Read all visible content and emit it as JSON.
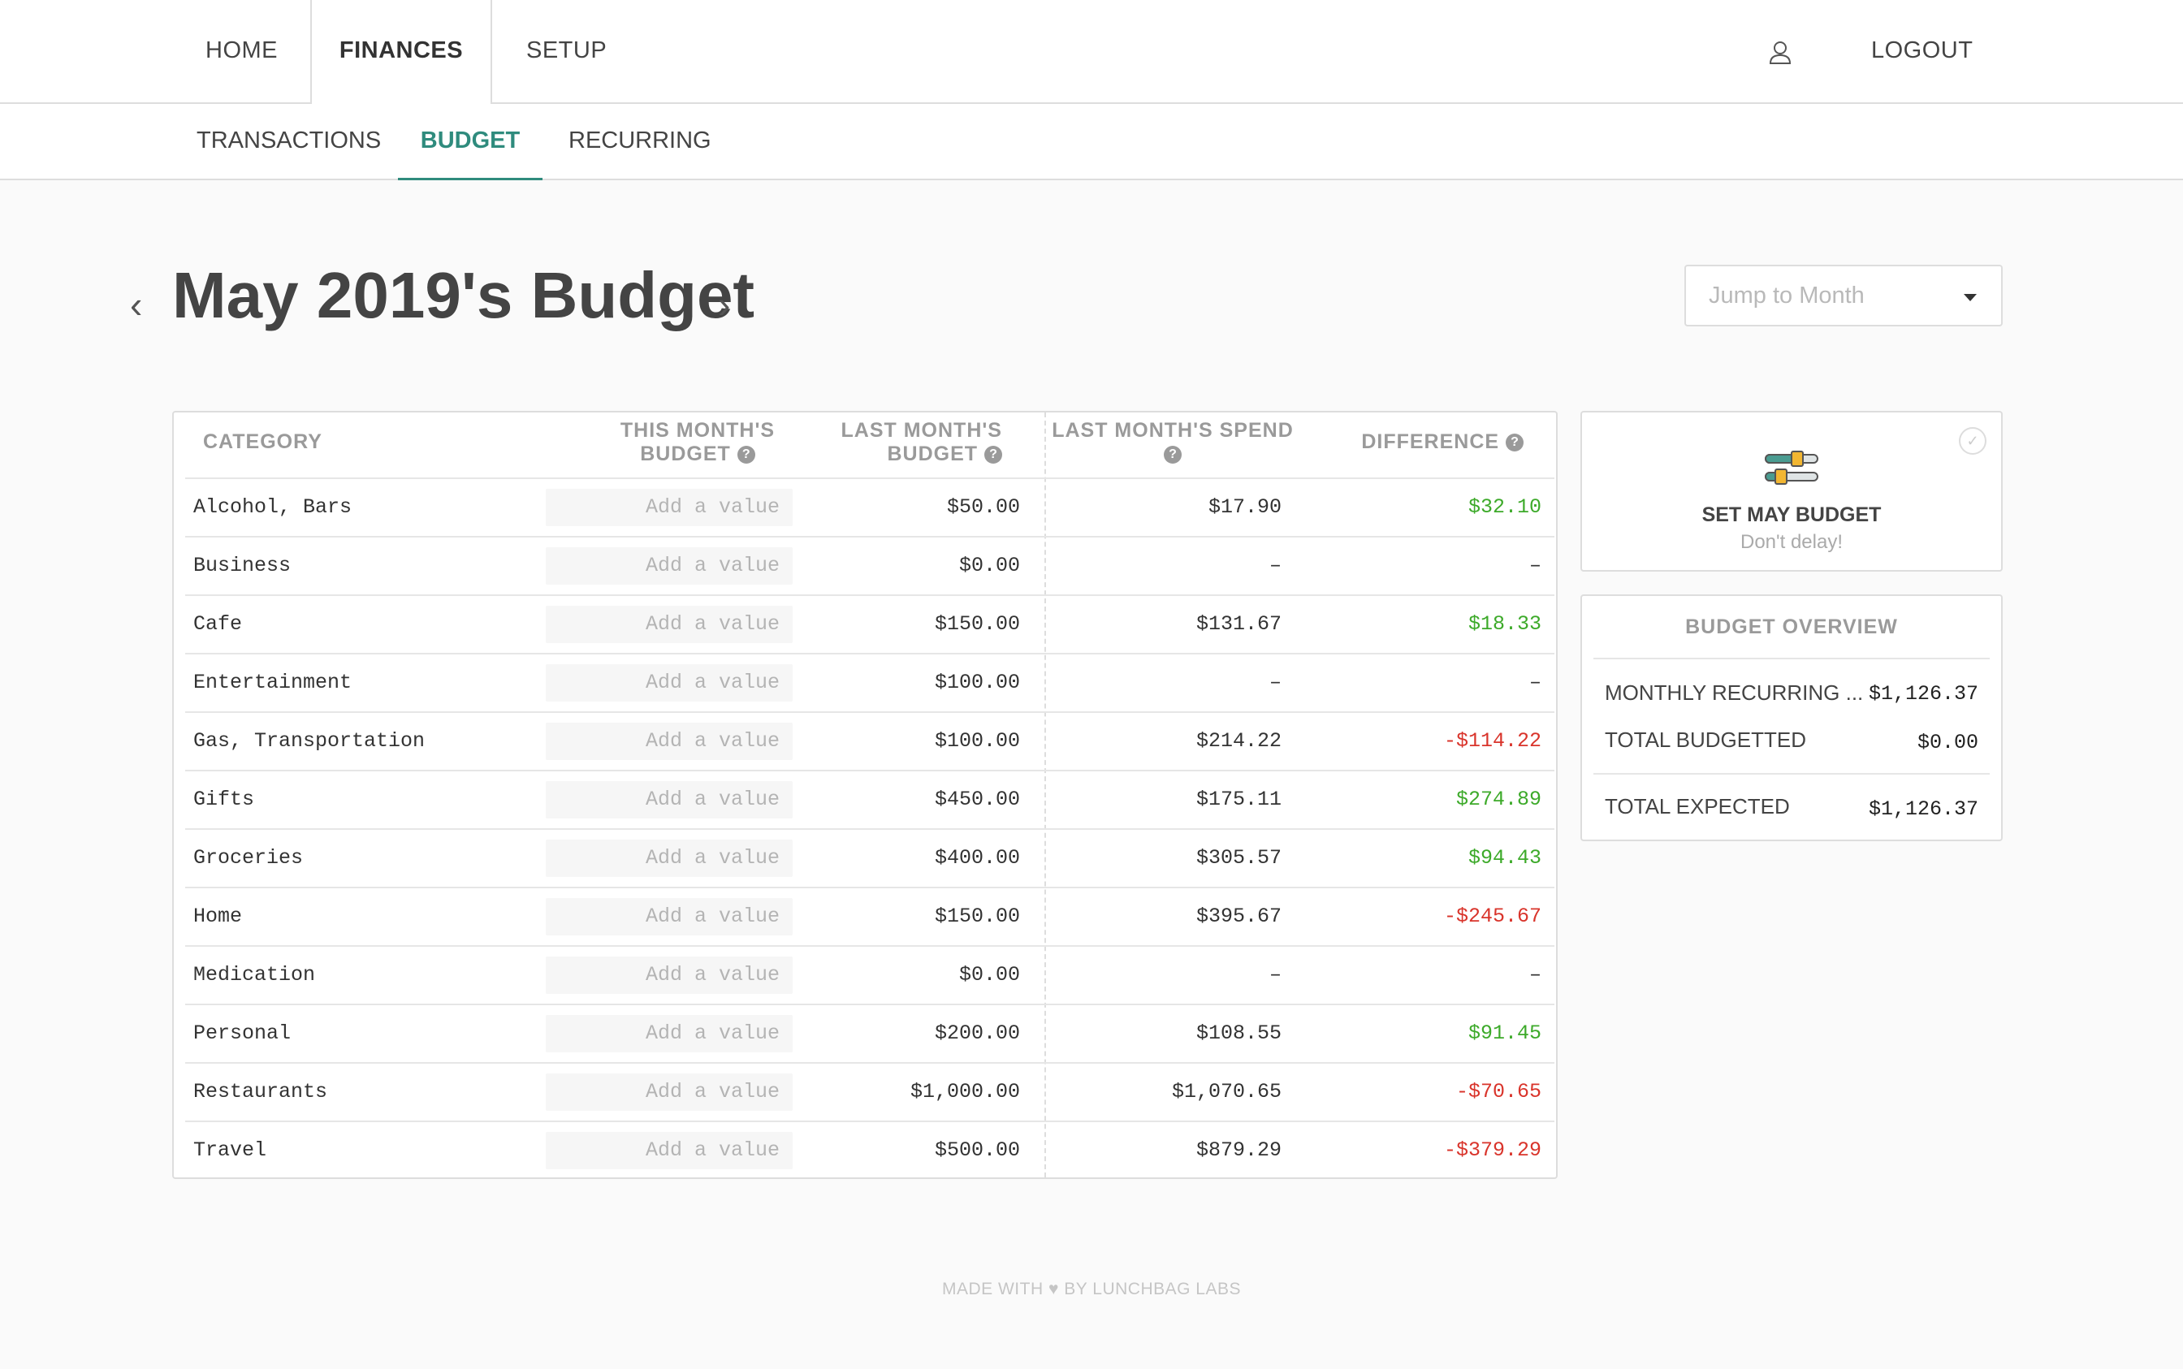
{
  "topnav": {
    "home": "HOME",
    "finances": "FINANCES",
    "setup": "SETUP",
    "logout": "LOGOUT"
  },
  "subnav": {
    "transactions": "TRANSACTIONS",
    "budget": "BUDGET",
    "recurring": "RECURRING"
  },
  "page": {
    "title": "May 2019's Budget",
    "prev_icon": "chevron-left-icon",
    "next_icon": "chevron-right-icon",
    "jump_placeholder": "Jump to Month"
  },
  "table": {
    "headers": {
      "category": "CATEGORY",
      "this_month_1": "THIS MONTH'S",
      "this_month_2": "BUDGET",
      "last_month_1": "LAST MONTH'S",
      "last_month_2": "BUDGET",
      "spend": "LAST MONTH'S SPEND",
      "difference": "DIFFERENCE"
    },
    "rows": [
      {
        "category": "Alcohol, Bars",
        "value": "Add a value",
        "last": "$50.00",
        "spend": "$17.90",
        "diff": "$32.10",
        "sign": "pos"
      },
      {
        "category": "Business",
        "value": "Add a value",
        "last": "$0.00",
        "spend": "–",
        "diff": "–",
        "sign": "neu"
      },
      {
        "category": "Cafe",
        "value": "Add a value",
        "last": "$150.00",
        "spend": "$131.67",
        "diff": "$18.33",
        "sign": "pos"
      },
      {
        "category": "Entertainment",
        "value": "Add a value",
        "last": "$100.00",
        "spend": "–",
        "diff": "–",
        "sign": "neu"
      },
      {
        "category": "Gas, Transportation",
        "value": "Add a value",
        "last": "$100.00",
        "spend": "$214.22",
        "diff": "-$114.22",
        "sign": "neg"
      },
      {
        "category": "Gifts",
        "value": "Add a value",
        "last": "$450.00",
        "spend": "$175.11",
        "diff": "$274.89",
        "sign": "pos"
      },
      {
        "category": "Groceries",
        "value": "Add a value",
        "last": "$400.00",
        "spend": "$305.57",
        "diff": "$94.43",
        "sign": "pos"
      },
      {
        "category": "Home",
        "value": "Add a value",
        "last": "$150.00",
        "spend": "$395.67",
        "diff": "-$245.67",
        "sign": "neg"
      },
      {
        "category": "Medication",
        "value": "Add a value",
        "last": "$0.00",
        "spend": "–",
        "diff": "–",
        "sign": "neu"
      },
      {
        "category": "Personal",
        "value": "Add a value",
        "last": "$200.00",
        "spend": "$108.55",
        "diff": "$91.45",
        "sign": "pos"
      },
      {
        "category": "Restaurants",
        "value": "Add a value",
        "last": "$1,000.00",
        "spend": "$1,070.65",
        "diff": "-$70.65",
        "sign": "neg"
      },
      {
        "category": "Travel",
        "value": "Add a value",
        "last": "$500.00",
        "spend": "$879.29",
        "diff": "-$379.29",
        "sign": "neg"
      }
    ]
  },
  "set_budget": {
    "title": "SET MAY BUDGET",
    "subtitle": "Don't delay!",
    "icon": "sliders-icon"
  },
  "overview": {
    "title": "BUDGET OVERVIEW",
    "monthly_recurring_label": "MONTHLY RECURRING ...",
    "monthly_recurring_value": "$1,126.37",
    "total_budgetted_label": "TOTAL BUDGETTED",
    "total_budgetted_value": "$0.00",
    "total_expected_label": "TOTAL EXPECTED",
    "total_expected_value": "$1,126.37"
  },
  "footer": {
    "made_with": "MADE WITH",
    "by": "BY LUNCHBAG LABS"
  },
  "colors": {
    "accent": "#2f8b7d",
    "positive": "#3daa2a",
    "negative": "#d9342b"
  }
}
